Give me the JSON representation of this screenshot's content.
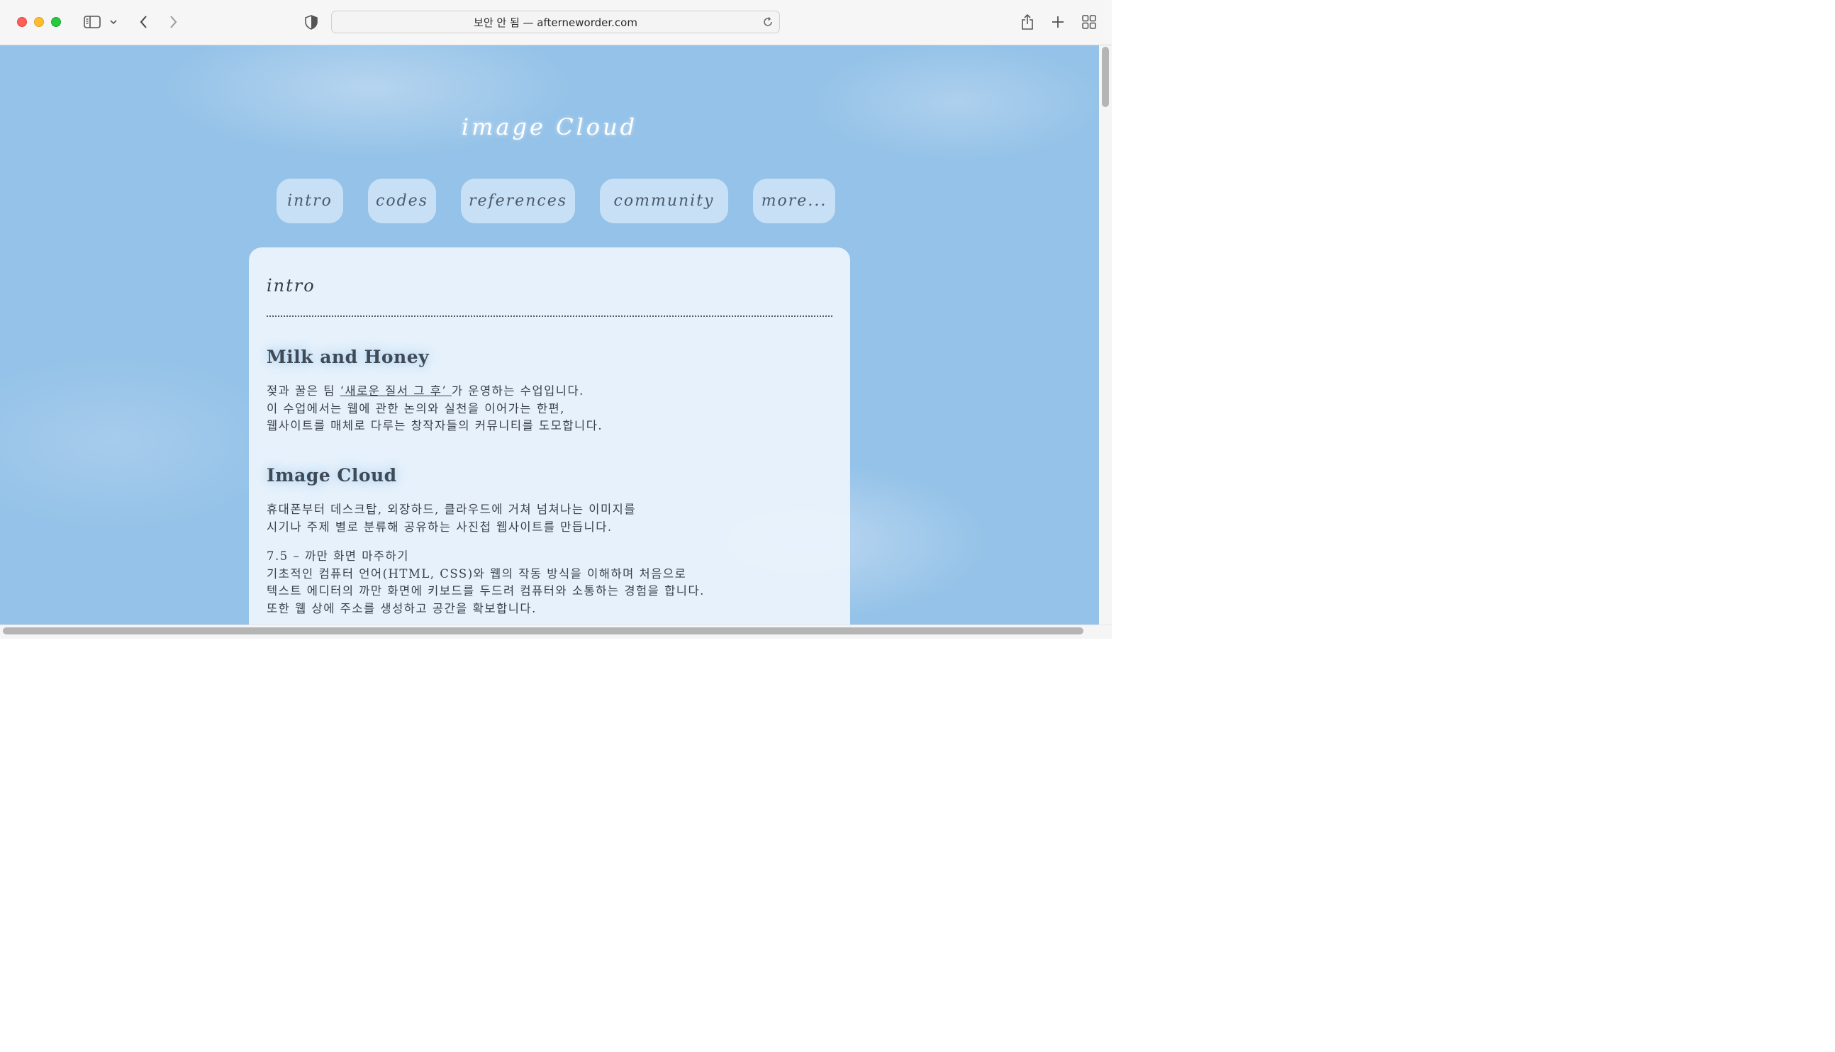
{
  "browser": {
    "address_text": "보안 안 됨 — afterneworder.com",
    "icons": [
      "sidebar-icon",
      "chevron-down-icon",
      "back-icon",
      "forward-icon",
      "privacy-shield-icon",
      "reload-icon",
      "share-icon",
      "new-tab-icon",
      "tab-overview-icon"
    ],
    "colors": {
      "close": "#fe5f57",
      "minimize": "#febc2e",
      "zoom": "#28c840"
    }
  },
  "page": {
    "site_title": "image Cloud",
    "nav": [
      "intro",
      "codes",
      "references",
      "community",
      "more..."
    ],
    "card_heading": "intro",
    "sections": [
      {
        "title": "Milk and Honey",
        "lines": [
          {
            "before": "젖과 꿀은 팀 ",
            "link": " ‘새로운 질서 그 후’ ",
            "after": "가 운영하는 수업입니다."
          },
          "이 수업에서는 웹에 관한 논의와 실천을 이어가는 한편,",
          "웹사이트를 매체로 다루는 창작자들의 커뮤니티를 도모합니다."
        ]
      },
      {
        "title": "Image Cloud",
        "lines": [
          "휴대폰부터 데스크탑, 외장하드, 클라우드에 거쳐 넘쳐나는 이미지를",
          "시기나 주제 별로 분류해 공유하는 사진첩 웹사이트를 만듭니다."
        ],
        "subsection": [
          "7.5 – 까만 화면 마주하기",
          "기초적인 컴퓨터 언어(HTML, CSS)와 웹의 작동 방식을 이해하며 처음으로",
          "텍스트 에디터의 까만 화면에 키보드를 두드려 컴퓨터와 소통하는 경험을 합니다.",
          "또한 웹 상에 주소를 생성하고 공간을 확보합니다."
        ]
      }
    ]
  }
}
